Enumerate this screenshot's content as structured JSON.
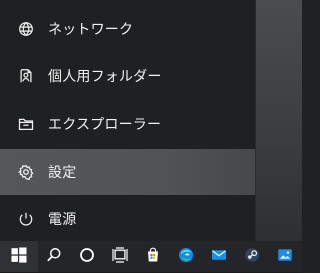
{
  "start_menu": {
    "items": [
      {
        "label": "ネットワーク",
        "icon": "network-icon"
      },
      {
        "label": "個人用フォルダー",
        "icon": "user-folder-icon"
      },
      {
        "label": "エクスプローラー",
        "icon": "file-explorer-icon"
      },
      {
        "label": "設定",
        "icon": "settings-gear-icon",
        "active": true
      },
      {
        "label": "電源",
        "icon": "power-icon"
      }
    ]
  },
  "taskbar": {
    "buttons": [
      {
        "icon": "windows-start-icon"
      },
      {
        "icon": "search-icon"
      },
      {
        "icon": "cortana-circle-icon"
      },
      {
        "icon": "task-view-icon"
      },
      {
        "icon": "store-bag-icon"
      },
      {
        "icon": "edge-browser-icon"
      },
      {
        "icon": "mail-icon"
      },
      {
        "icon": "steam-icon"
      },
      {
        "icon": "photos-icon"
      }
    ],
    "accent": "#0078d7"
  }
}
